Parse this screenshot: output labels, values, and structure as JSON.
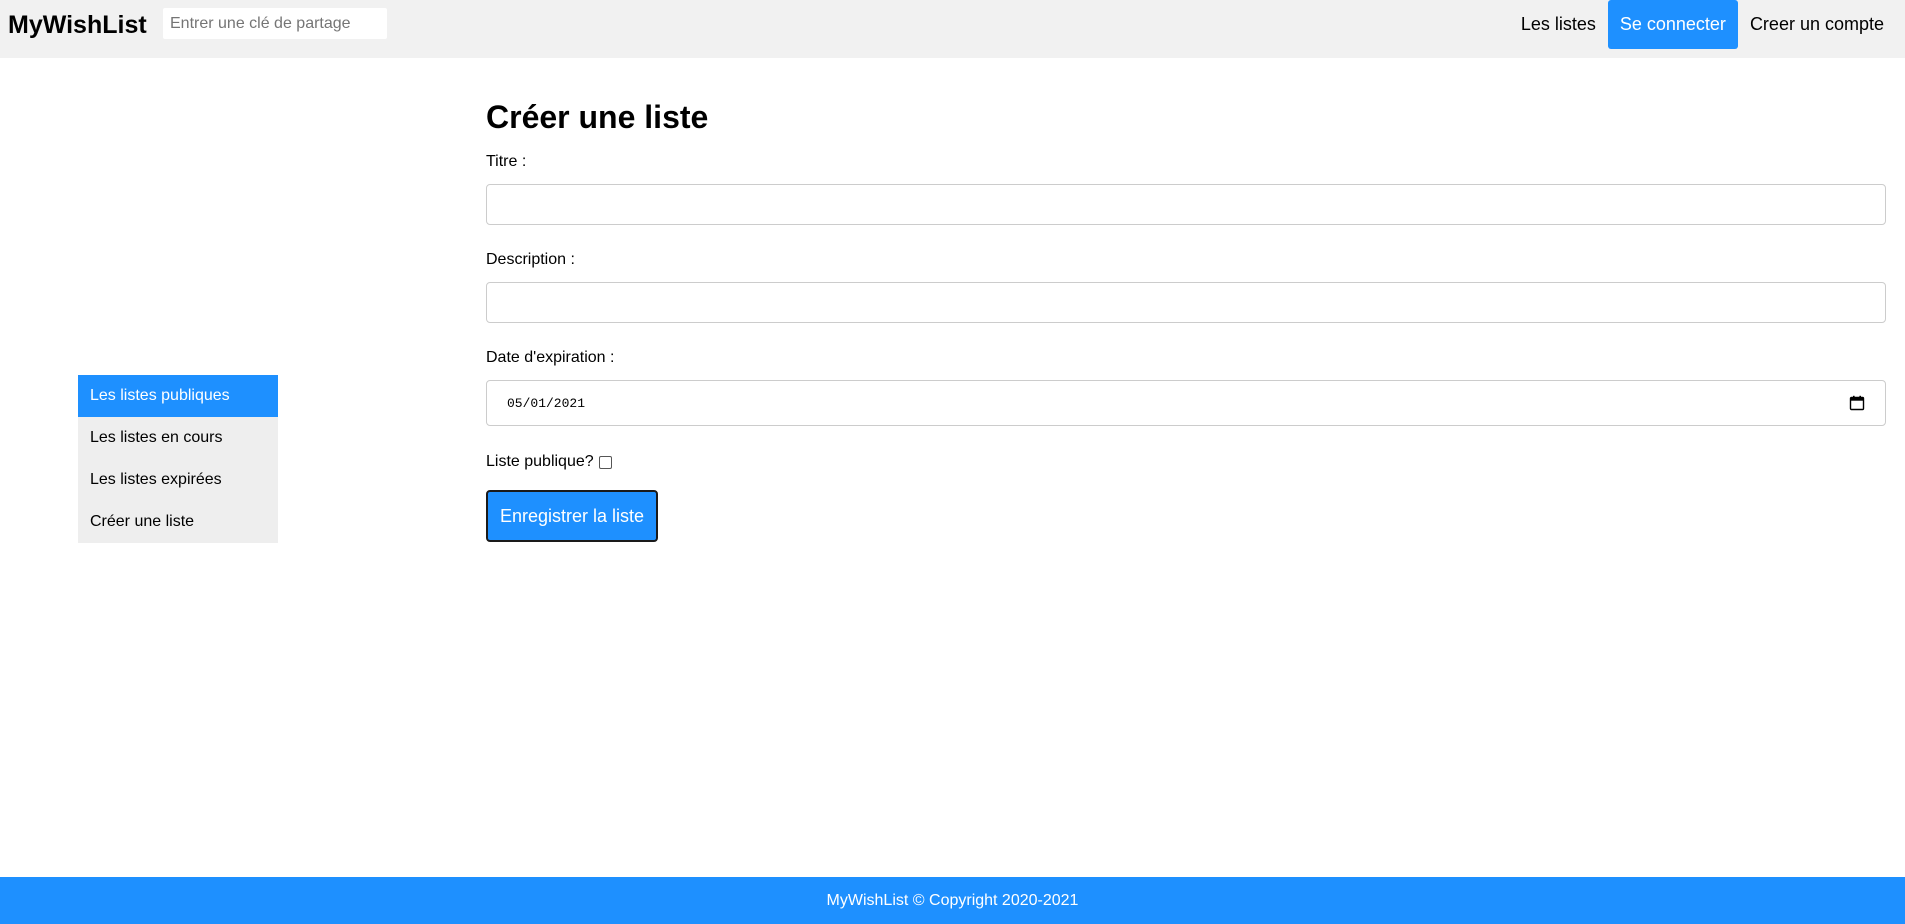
{
  "header": {
    "brand": "MyWishList",
    "share_key_placeholder": "Entrer une clé de partage",
    "nav": {
      "lists": "Les listes",
      "login": "Se connecter",
      "register": "Creer un compte"
    }
  },
  "sidebar": {
    "items": [
      {
        "label": "Les listes publiques",
        "active": true
      },
      {
        "label": "Les listes en cours",
        "active": false
      },
      {
        "label": "Les listes expirées",
        "active": false
      },
      {
        "label": "Créer une liste",
        "active": false
      }
    ]
  },
  "form": {
    "title": "Créer une liste",
    "title_label": "Titre :",
    "title_value": "",
    "description_label": "Description :",
    "description_value": "",
    "expiration_label": "Date d'expiration :",
    "expiration_value": "05/01/2021",
    "public_label": "Liste publique?",
    "public_checked": false,
    "submit_label": "Enregistrer la liste"
  },
  "footer": {
    "text": "MyWishList © Copyright 2020-2021"
  },
  "colors": {
    "accent": "#1e90ff",
    "topbar_bg": "#f1f1f1",
    "sidebar_bg": "#eeeeee"
  },
  "icons": {
    "calendar": "calendar-icon"
  }
}
